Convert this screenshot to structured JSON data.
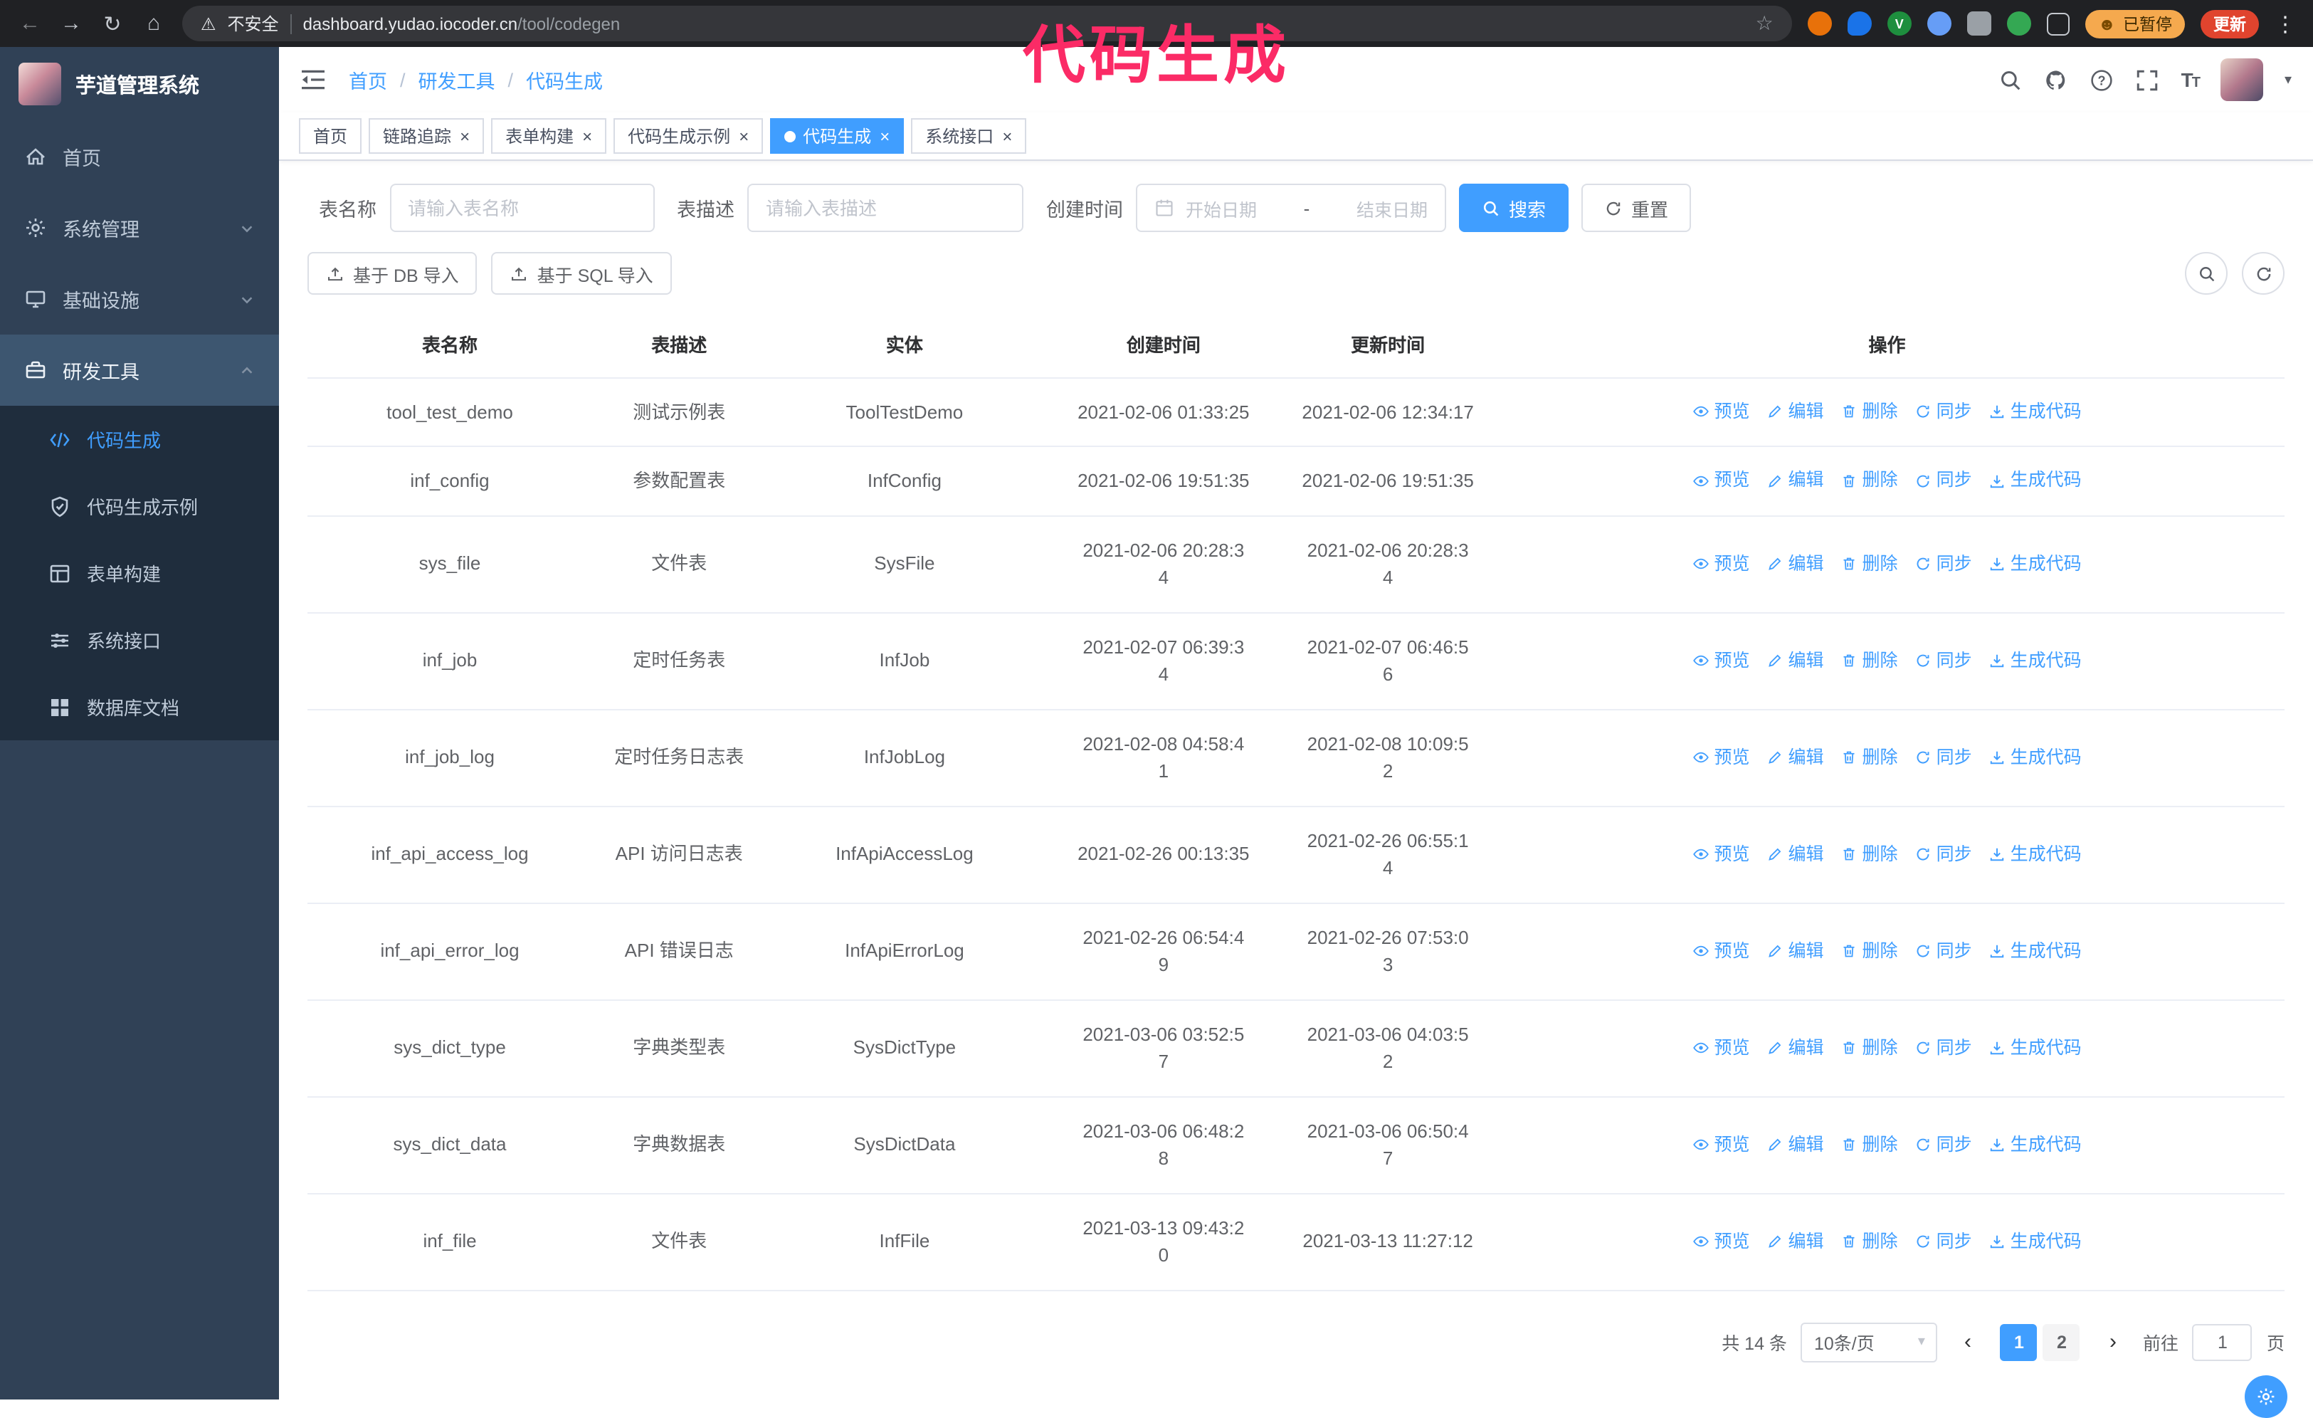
{
  "theme": {
    "accent": "#409eff",
    "sidebar_bg": "#304156",
    "submenu_bg": "#1f2d3d",
    "annotation_color": "#fb2b66",
    "update_button_red": "#e0442e",
    "paused_badge_orange": "#f5a94e"
  },
  "browser": {
    "security_label": "不安全",
    "url_domain": "dashboard.yudao.iocoder.cn",
    "url_path": "/tool/codegen",
    "paused_badge": "已暂停",
    "update_button": "更新"
  },
  "annotation": {
    "text": "代码生成"
  },
  "sidebar": {
    "logo_title": "芋道管理系统",
    "items": [
      {
        "label": "首页",
        "expandable": false,
        "expanded": false
      },
      {
        "label": "系统管理",
        "expandable": true,
        "expanded": false
      },
      {
        "label": "基础设施",
        "expandable": true,
        "expanded": false
      },
      {
        "label": "研发工具",
        "expandable": true,
        "expanded": true
      }
    ],
    "submenu": [
      {
        "label": "代码生成",
        "active": true
      },
      {
        "label": "代码生成示例",
        "active": false
      },
      {
        "label": "表单构建",
        "active": false
      },
      {
        "label": "系统接口",
        "active": false
      },
      {
        "label": "数据库文档",
        "active": false
      }
    ]
  },
  "breadcrumb": [
    "首页",
    "研发工具",
    "代码生成"
  ],
  "tabs": [
    {
      "label": "首页",
      "closable": false,
      "active": false
    },
    {
      "label": "链路追踪",
      "closable": true,
      "active": false
    },
    {
      "label": "表单构建",
      "closable": true,
      "active": false
    },
    {
      "label": "代码生成示例",
      "closable": true,
      "active": false
    },
    {
      "label": "代码生成",
      "closable": true,
      "active": true
    },
    {
      "label": "系统接口",
      "closable": true,
      "active": false
    }
  ],
  "filters": {
    "name_label": "表名称",
    "name_placeholder": "请输入表名称",
    "desc_label": "表描述",
    "desc_placeholder": "请输入表描述",
    "time_label": "创建时间",
    "start_placeholder": "开始日期",
    "range_separator": "-",
    "end_placeholder": "结束日期",
    "search_button": "搜索",
    "reset_button": "重置"
  },
  "toolbar": {
    "import_db_button": "基于 DB 导入",
    "import_sql_button": "基于 SQL 导入"
  },
  "table": {
    "columns": [
      "表名称",
      "表描述",
      "实体",
      "创建时间",
      "更新时间",
      "操作"
    ],
    "actions": [
      "预览",
      "编辑",
      "删除",
      "同步",
      "生成代码"
    ],
    "rows": [
      {
        "name": "tool_test_demo",
        "desc": "测试示例表",
        "entity": "ToolTestDemo",
        "created": "2021-02-06 01:33:25",
        "updated": "2021-02-06 12:34:17"
      },
      {
        "name": "inf_config",
        "desc": "参数配置表",
        "entity": "InfConfig",
        "created": "2021-02-06 19:51:35",
        "updated": "2021-02-06 19:51:35"
      },
      {
        "name": "sys_file",
        "desc": "文件表",
        "entity": "SysFile",
        "created": "2021-02-06 20:28:34",
        "updated": "2021-02-06 20:28:34"
      },
      {
        "name": "inf_job",
        "desc": "定时任务表",
        "entity": "InfJob",
        "created": "2021-02-07 06:39:34",
        "updated": "2021-02-07 06:46:56"
      },
      {
        "name": "inf_job_log",
        "desc": "定时任务日志表",
        "entity": "InfJobLog",
        "created": "2021-02-08 04:58:41",
        "updated": "2021-02-08 10:09:52"
      },
      {
        "name": "inf_api_access_log",
        "desc": "API 访问日志表",
        "entity": "InfApiAccessLog",
        "created": "2021-02-26 00:13:35",
        "updated": "2021-02-26 06:55:14"
      },
      {
        "name": "inf_api_error_log",
        "desc": "API 错误日志",
        "entity": "InfApiErrorLog",
        "created": "2021-02-26 06:54:49",
        "updated": "2021-02-26 07:53:03"
      },
      {
        "name": "sys_dict_type",
        "desc": "字典类型表",
        "entity": "SysDictType",
        "created": "2021-03-06 03:52:57",
        "updated": "2021-03-06 04:03:52"
      },
      {
        "name": "sys_dict_data",
        "desc": "字典数据表",
        "entity": "SysDictData",
        "created": "2021-03-06 06:48:28",
        "updated": "2021-03-06 06:50:47"
      },
      {
        "name": "inf_file",
        "desc": "文件表",
        "entity": "InfFile",
        "created": "2021-03-13 09:43:20",
        "updated": "2021-03-13 11:27:12"
      }
    ]
  },
  "pagination": {
    "total_text": "共 14 条",
    "page_size": "10条/页",
    "pages": [
      "1",
      "2"
    ],
    "active_page": "1",
    "goto_label": "前往",
    "goto_value": "1",
    "goto_suffix": "页"
  }
}
